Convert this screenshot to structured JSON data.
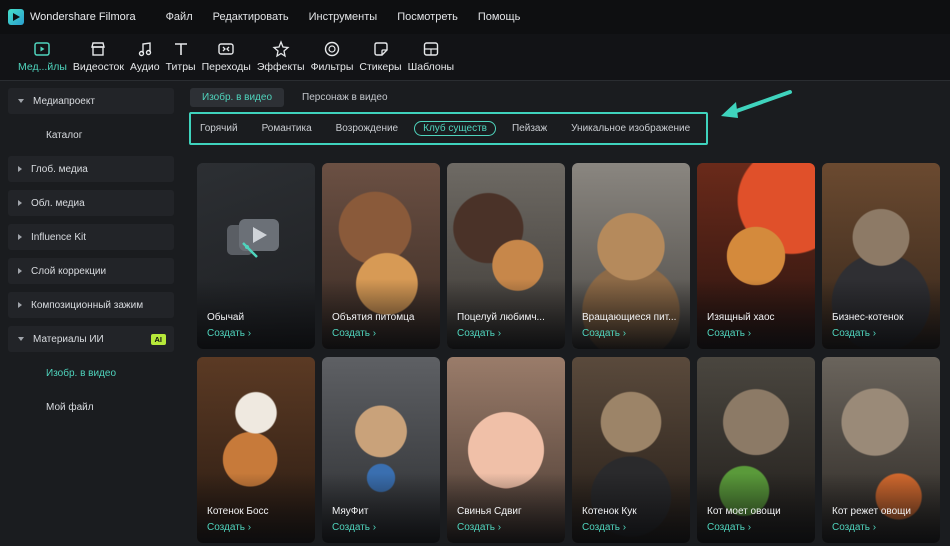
{
  "app": {
    "name": "Wondershare Filmora"
  },
  "menu": [
    "Файл",
    "Редактировать",
    "Инструменты",
    "Посмотреть",
    "Помощь"
  ],
  "toolbar": [
    {
      "label": "Мед...йлы",
      "icon": "media-icon"
    },
    {
      "label": "Видеосток",
      "icon": "stock-icon"
    },
    {
      "label": "Аудио",
      "icon": "audio-icon"
    },
    {
      "label": "Титры",
      "icon": "titles-icon"
    },
    {
      "label": "Переходы",
      "icon": "transitions-icon"
    },
    {
      "label": "Эффекты",
      "icon": "effects-icon"
    },
    {
      "label": "Фильтры",
      "icon": "filters-icon"
    },
    {
      "label": "Стикеры",
      "icon": "stickers-icon"
    },
    {
      "label": "Шаблоны",
      "icon": "templates-icon"
    }
  ],
  "sidebar": {
    "items": [
      {
        "label": "Медиапроект"
      },
      {
        "label": "Каталог"
      },
      {
        "label": "Глоб. медиа"
      },
      {
        "label": "Обл. медиа"
      },
      {
        "label": "Influence Kit"
      },
      {
        "label": "Слой коррекции"
      },
      {
        "label": "Композиционный зажим"
      },
      {
        "label": "Материалы ИИ",
        "badge": "AI"
      },
      {
        "label": "Изобр. в видео"
      },
      {
        "label": "Мой файл"
      }
    ]
  },
  "tabs": [
    "Изобр. в видео",
    "Персонаж в видео"
  ],
  "filters": [
    "Горячий",
    "Романтика",
    "Возрождение",
    "Клуб существ",
    "Пейзаж",
    "Уникальное изображение"
  ],
  "create_label": "Создать",
  "cards": [
    {
      "title": "Обычай"
    },
    {
      "title": "Объятия питомца"
    },
    {
      "title": "Поцелуй любимч..."
    },
    {
      "title": "Вращающиеся пит..."
    },
    {
      "title": "Изящный хаос"
    },
    {
      "title": "Бизнес-котенок"
    },
    {
      "title": "Котенок Босс"
    },
    {
      "title": "МяуФит"
    },
    {
      "title": "Свинья Сдвиг"
    },
    {
      "title": "Котенок Кук"
    },
    {
      "title": "Кот моет овощи"
    },
    {
      "title": "Кот режет овощи"
    }
  ],
  "colors": {
    "accent": "#4fd4bd",
    "highlight_box": "#3fd3bd",
    "ai_badge": "#b7e93a"
  }
}
